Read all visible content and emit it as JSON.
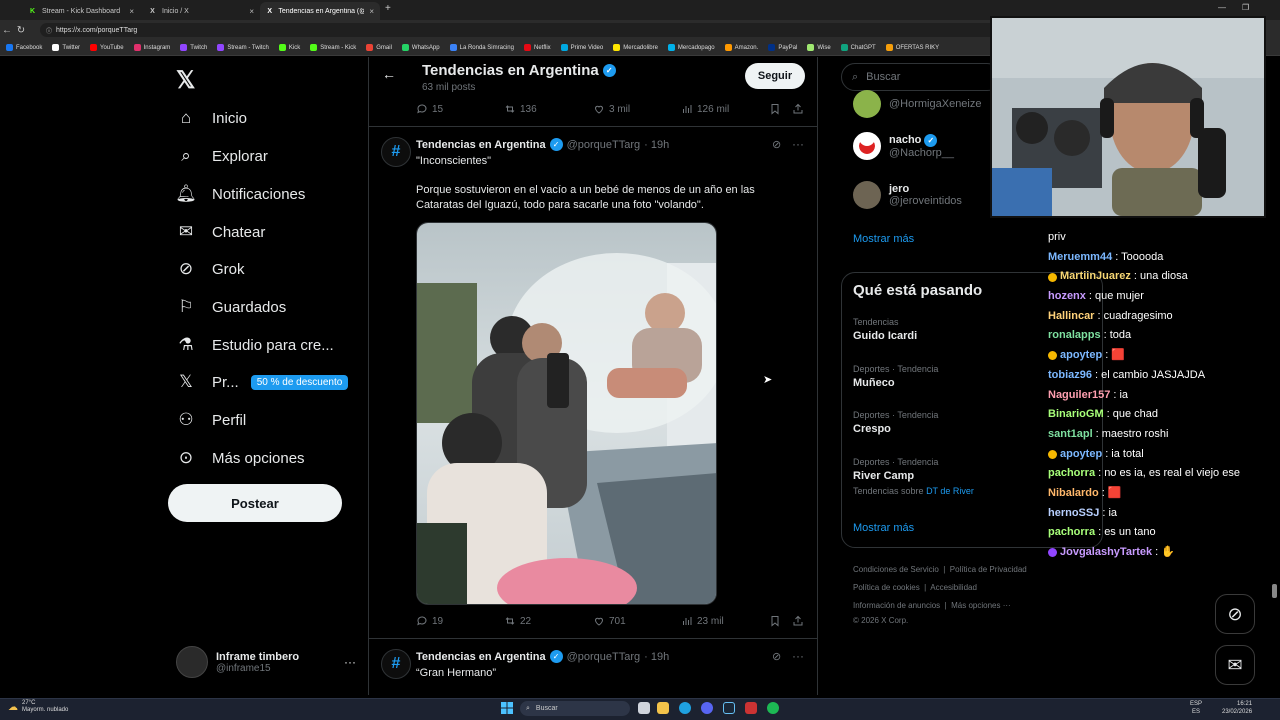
{
  "browser": {
    "tabs": [
      {
        "label": "Stream - Kick Dashboard",
        "icon_color": "#53fc18",
        "active": false
      },
      {
        "label": "Inicio / X",
        "icon_color": "#ffffff",
        "active": false
      },
      {
        "label": "Tendencias en Argentina (@porqu",
        "icon_color": "#ffffff",
        "active": true
      }
    ],
    "url": "https://x.com/porqueTTarg",
    "bookmarks": [
      {
        "label": "Facebook",
        "color": "#1877f2"
      },
      {
        "label": "Twitter",
        "color": "#ffffff"
      },
      {
        "label": "YouTube",
        "color": "#ff0000"
      },
      {
        "label": "Instagram",
        "color": "#e1306c"
      },
      {
        "label": "Twitch",
        "color": "#9146ff"
      },
      {
        "label": "Stream - Twitch",
        "color": "#9146ff"
      },
      {
        "label": "Kick",
        "color": "#53fc18"
      },
      {
        "label": "Stream - Kick",
        "color": "#53fc18"
      },
      {
        "label": "Gmail",
        "color": "#ea4335"
      },
      {
        "label": "WhatsApp",
        "color": "#25d366"
      },
      {
        "label": "La Ronda Simracing",
        "color": "#3b82f6"
      },
      {
        "label": "Netflix",
        "color": "#e50914"
      },
      {
        "label": "Prime Video",
        "color": "#00a8e1"
      },
      {
        "label": "Mercadolibre",
        "color": "#ffe600"
      },
      {
        "label": "Mercadopago",
        "color": "#00b1ea"
      },
      {
        "label": "Amazon.",
        "color": "#ff9900"
      },
      {
        "label": "PayPal",
        "color": "#003087"
      },
      {
        "label": "Wise",
        "color": "#9fe870"
      },
      {
        "label": "ChatGPT",
        "color": "#10a37f"
      },
      {
        "label": "OFERTAS RIKY",
        "color": "#f59e0b"
      }
    ]
  },
  "nav": {
    "items": [
      {
        "label": "Inicio",
        "icon": "home-icon"
      },
      {
        "label": "Explorar",
        "icon": "search-icon"
      },
      {
        "label": "Notificaciones",
        "icon": "bell-icon"
      },
      {
        "label": "Chatear",
        "icon": "mail-icon"
      },
      {
        "label": "Grok",
        "icon": "grok-icon"
      },
      {
        "label": "Guardados",
        "icon": "bookmark-icon"
      },
      {
        "label": "Estudio para cre...",
        "icon": "flask-icon"
      },
      {
        "label": "Pr...",
        "icon": "x-logo-icon",
        "promo": "50 % de descuento"
      },
      {
        "label": "Perfil",
        "icon": "person-icon"
      },
      {
        "label": "Más opciones",
        "icon": "more-circle-icon"
      }
    ],
    "post_label": "Postear",
    "account": {
      "name": "Inframe timbero",
      "handle": "@inframe15"
    }
  },
  "header": {
    "title": "Tendencias en Argentina",
    "subtitle": "63 mil posts",
    "follow_label": "Seguir"
  },
  "top_actions": {
    "replies": "15",
    "reposts": "136",
    "likes": "3 mil",
    "views": "126 mil"
  },
  "tweet1": {
    "name": "Tendencias en Argentina",
    "handle": "@porqueTTarg",
    "time": "· 19h",
    "quote": "\"Inconscientes\"",
    "text": "Porque sostuvieron en el vacío a un bebé de menos de un año en las Cataratas del Iguazú, todo para sacarle una foto \"volando\".",
    "actions": {
      "replies": "19",
      "reposts": "22",
      "likes": "701",
      "views": "23 mil"
    }
  },
  "tweet2": {
    "name": "Tendencias en Argentina",
    "handle": "@porqueTTarg",
    "time": "· 19h",
    "quote": "“Gran Hermano”"
  },
  "sidebar": {
    "search_placeholder": "Buscar",
    "who": [
      {
        "name": "",
        "handle": "@HormigaXeneize",
        "verified": false
      },
      {
        "name": "nacho",
        "handle": "@Nachorp__",
        "verified": true
      },
      {
        "name": "jero",
        "handle": "@jeroveintidos",
        "verified": false
      }
    ],
    "show_more": "Mostrar más",
    "trends_title": "Qué está pasando",
    "trends": [
      {
        "category": "Tendencias",
        "name": "Guido Icardi",
        "sub": "",
        "sub_link": ""
      },
      {
        "category": "Deportes · Tendencia",
        "name": "Muñeco",
        "sub": "",
        "sub_link": ""
      },
      {
        "category": "Deportes · Tendencia",
        "name": "Crespo",
        "sub": "",
        "sub_link": ""
      },
      {
        "category": "Deportes · Tendencia",
        "name": "River Camp",
        "sub": "Tendencias sobre",
        "sub_link": "DT de River"
      }
    ],
    "trends_show_more": "Mostrar más",
    "footer": {
      "links1": [
        "Condiciones de Servicio",
        "Política de Privacidad"
      ],
      "links2": [
        "Política de cookies",
        "Accesibilidad"
      ],
      "links3": [
        "Información de anuncios",
        "Más opciones ···"
      ],
      "copyright": "© 2026 X Corp."
    }
  },
  "chat": {
    "first": "priv",
    "lines": [
      {
        "user": "Meruemm44",
        "color": "#7cb8ff",
        "msg": ": Tooooda"
      },
      {
        "user": "MartiinJuarez",
        "color": "#f7d774",
        "msg": ": una diosa"
      },
      {
        "user": "hozenx",
        "color": "#c89bff",
        "msg": ": que mujer"
      },
      {
        "user": "Hallincar",
        "color": "#ffd27a",
        "msg": ": cuadragesimo"
      },
      {
        "user": "ronalapps",
        "color": "#7ee0a0",
        "msg": ": toda"
      },
      {
        "user": "apoytep",
        "color": "#7cb8ff",
        "msg": ": 🟥"
      },
      {
        "user": "tobiaz96",
        "color": "#7cb8ff",
        "msg": ": el cambio JASJAJDA"
      },
      {
        "user": "Naguiler157",
        "color": "#ff9fb0",
        "msg": ": ia"
      },
      {
        "user": "BinarioGM",
        "color": "#a8ff7a",
        "msg": ": que chad"
      },
      {
        "user": "sant1apl",
        "color": "#7ee0a0",
        "msg": ": maestro roshi"
      },
      {
        "user": "apoytep",
        "color": "#7cb8ff",
        "msg": ": ia total"
      },
      {
        "user": "pachorra",
        "color": "#a8ff7a",
        "msg": ": no es ia, es real el viejo ese"
      },
      {
        "user": "Nibalardo",
        "color": "#ffb86b",
        "msg": ": 🟥"
      },
      {
        "user": "hernoSSJ",
        "color": "#b8d0ff",
        "msg": ": ia"
      },
      {
        "user": "pachorra",
        "color": "#a8ff7a",
        "msg": ": es un tano"
      },
      {
        "user": "JovgalashyTartek",
        "color": "#c89bff",
        "msg": ": ✋"
      }
    ]
  },
  "taskbar": {
    "temp": "27°C",
    "weather": "Mayorm. nublado",
    "search": "Buscar",
    "lang1": "ESP",
    "lang2": "ES",
    "time": "16:21",
    "date": "23/02/2026"
  }
}
